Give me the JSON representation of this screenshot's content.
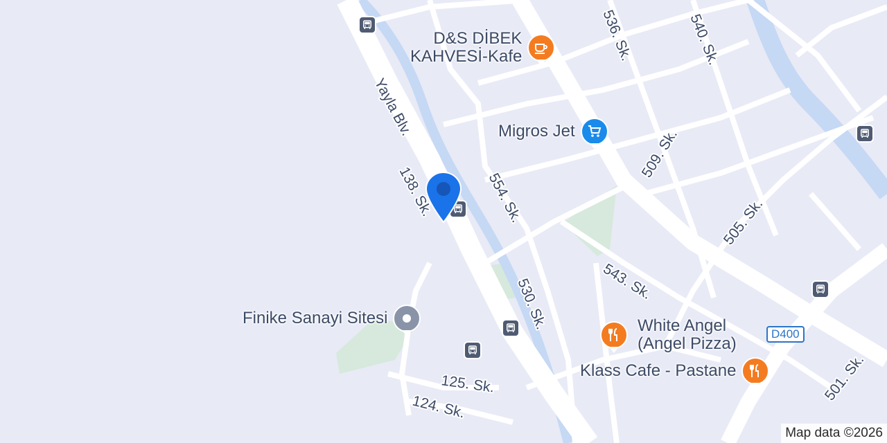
{
  "map": {
    "colors": {
      "background": "#e8eaf6",
      "road": "#ffffff",
      "water": "#c5d8f4",
      "park": "#d6e9dc",
      "label": "#3c4a66",
      "accent": "#1a73e8"
    },
    "streets": [
      {
        "label": "Yayla Blv."
      },
      {
        "label": "138. Sk."
      },
      {
        "label": "554. Sk."
      },
      {
        "label": "530. Sk."
      },
      {
        "label": "536. Sk."
      },
      {
        "label": "540. Sk."
      },
      {
        "label": "509. Sk."
      },
      {
        "label": "505. Sk."
      },
      {
        "label": "543. Sk."
      },
      {
        "label": "501. Sk."
      },
      {
        "label": "125. Sk."
      },
      {
        "label": "124. Sk."
      }
    ],
    "pois": [
      {
        "label": "D&S DİBEK KAHVESİ-Kafe",
        "line1": "D&S DİBEK",
        "line2": "KAHVESİ-Kafe",
        "icon": "coffee-icon",
        "color": "#f47c20"
      },
      {
        "label": "Migros Jet",
        "icon": "shopping-cart-icon",
        "color": "#1a8bea"
      },
      {
        "label": "Finike Sanayi Sitesi",
        "icon": "place-icon",
        "color": "#8a94a8"
      },
      {
        "label": "White Angel (Angel Pizza)",
        "line1": "White Angel",
        "line2": "(Angel Pizza)",
        "icon": "restaurant-icon",
        "color": "#f47c20"
      },
      {
        "label": "Klass Cafe - Pastane",
        "icon": "restaurant-icon",
        "color": "#f47c20"
      }
    ],
    "route_shield": "D400",
    "attribution": "Map data ©2026",
    "bus_stop_icon": "bus-stop-icon",
    "location_marker": "location-pin-icon"
  }
}
